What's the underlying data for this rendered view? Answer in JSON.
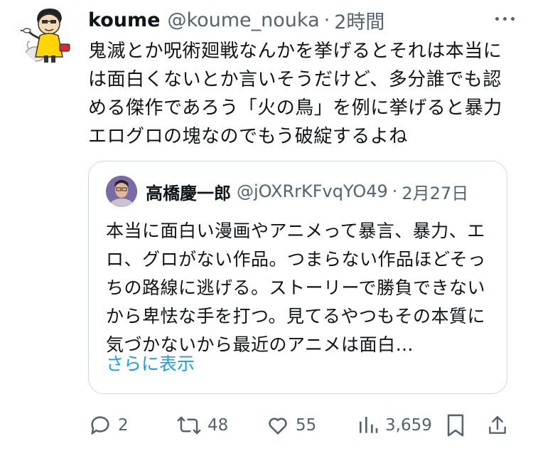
{
  "author": {
    "display_name": "koume",
    "handle": "@koume_nouka",
    "separator": "·",
    "time": "2時間",
    "avatar_icon": "cartoon-farmer-avatar-icon",
    "more_icon": "more-dots-icon"
  },
  "post": {
    "text": "鬼滅とか呪術廻戦なんかを挙げるとそれは本当には面白くないとか言いそうだけど、多分誰でも認める傑作であろう「火の鳥」を例に挙げると暴力エログロの塊なのでもう破綻するよね"
  },
  "quote": {
    "display_name": "高橋慶一郎",
    "handle": "@jOXRrKFvqYO49",
    "separator": "·",
    "date": "2月27日",
    "avatar_icon": "person-photo-avatar-icon",
    "text": "本当に面白い漫画やアニメって暴言、暴力、エロ、グロがない作品。つまらない作品ほどそっちの路線に逃げる。ストーリーで勝負できないから卑怯な手を打つ。見てるやつもその本質に気づかないから最近のアニメは面白…",
    "show_more": "さらに表示"
  },
  "actions": {
    "reply_count": "2",
    "repost_count": "48",
    "like_count": "55",
    "views_count": "3,659"
  },
  "colors": {
    "text_primary": "#0f1419",
    "text_secondary": "#536471",
    "link": "#1d9bf0",
    "border": "#cfd9de"
  }
}
